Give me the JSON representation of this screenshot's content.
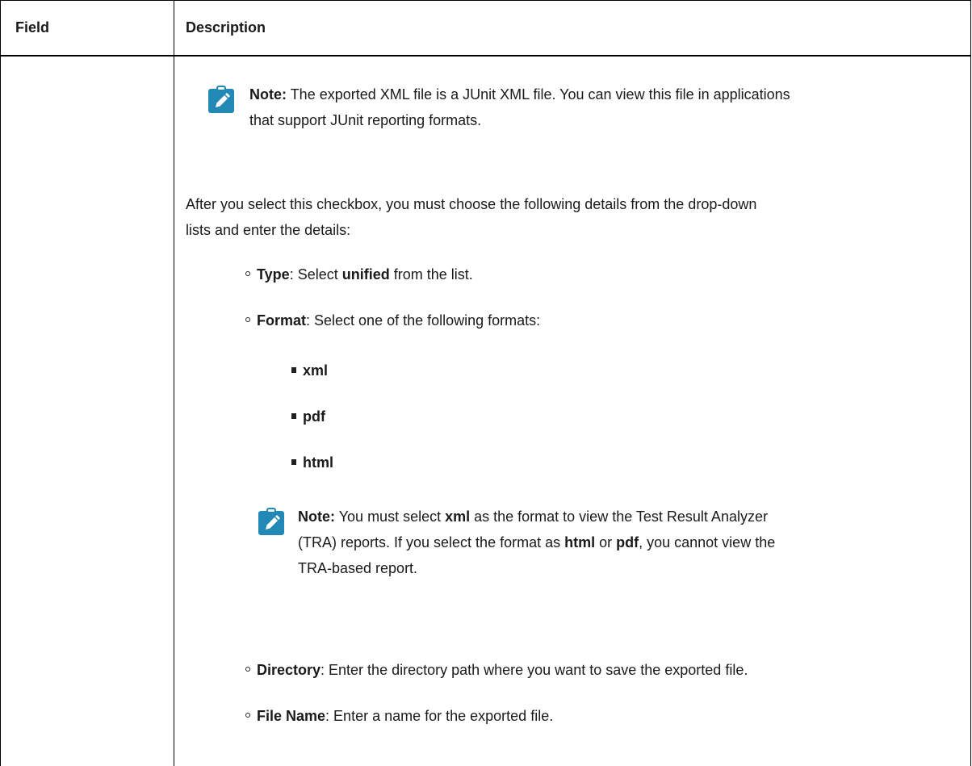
{
  "table": {
    "headers": {
      "field": "Field",
      "description": "Description"
    }
  },
  "note1": {
    "label": "Note:",
    "text": "The exported XML file is a JUnit XML file. You can view this file in applications",
    "text2": "that support JUnit reporting formats."
  },
  "intro": {
    "line1": "After you select this checkbox, you must choose the following details from the drop-down",
    "line2": "lists and enter the details:"
  },
  "items": {
    "type": {
      "label": "Type",
      "text_pre": ": Select ",
      "value": "unified",
      "text_post": " from the list."
    },
    "format": {
      "label": "Format",
      "text": ": Select one of the following formats:"
    },
    "formats": [
      "xml",
      "pdf",
      "html"
    ],
    "directory": {
      "label": "Directory",
      "text": ": Enter the directory path where you want to save the exported file."
    },
    "file_name": {
      "label": "File Name",
      "text": ": Enter a name for the exported file."
    }
  },
  "note2": {
    "label": "Note:",
    "t1": "You must select ",
    "b1": "xml",
    "t2": " as the format to view the Test Result Analyzer",
    "t3": "(TRA) reports. If you select the format as ",
    "b2": "html",
    "t4": " or ",
    "b3": "pdf",
    "t5": ", you cannot view the",
    "t6": "TRA-based report."
  },
  "colors": {
    "note_icon": "#2289b7",
    "border": "#000000",
    "text": "#1a1a1a"
  },
  "icons": {
    "note": "pencil-note-icon"
  }
}
